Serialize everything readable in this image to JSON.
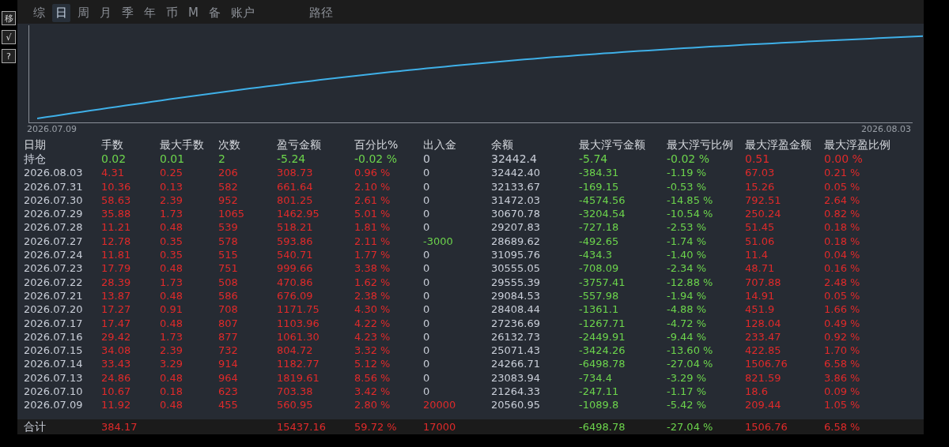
{
  "side_buttons": [
    "移",
    "√",
    "?"
  ],
  "tabs": [
    {
      "label": "综",
      "selected": false
    },
    {
      "label": "日",
      "selected": true
    },
    {
      "label": "周",
      "selected": false
    },
    {
      "label": "月",
      "selected": false
    },
    {
      "label": "季",
      "selected": false
    },
    {
      "label": "年",
      "selected": false
    },
    {
      "label": "币",
      "selected": false
    },
    {
      "label": "M",
      "selected": false
    },
    {
      "label": "备",
      "selected": false
    },
    {
      "label": "账户",
      "selected": false
    }
  ],
  "path_tab": {
    "label": "路径",
    "selected": false
  },
  "chart": {
    "start_label": "2026.07.09",
    "end_label": "2026.08.03"
  },
  "table": {
    "columns": [
      "日期",
      "手数",
      "最大手数",
      "次数",
      "盈亏金额",
      "百分比%",
      "出入金",
      "余额",
      "最大浮亏金额",
      "最大浮亏比例",
      "最大浮盈金额",
      "最大浮盈比例"
    ],
    "rows": [
      {
        "kind": "position",
        "cells": [
          "持仓",
          "0.02",
          "0.01",
          "2",
          "-5.24",
          "-0.02 %",
          "0",
          "32442.4",
          "-5.74",
          "-0.02 %",
          "0.51",
          "0.00 %"
        ]
      },
      {
        "kind": "day",
        "cells": [
          "2026.08.03",
          "4.31",
          "0.25",
          "206",
          "308.73",
          "0.96 %",
          "0",
          "32442.40",
          "-384.31",
          "-1.19 %",
          "67.03",
          "0.21 %"
        ]
      },
      {
        "kind": "day",
        "cells": [
          "2026.07.31",
          "10.36",
          "0.13",
          "582",
          "661.64",
          "2.10 %",
          "0",
          "32133.67",
          "-169.15",
          "-0.53 %",
          "15.26",
          "0.05 %"
        ]
      },
      {
        "kind": "day",
        "cells": [
          "2026.07.30",
          "58.63",
          "2.39",
          "952",
          "801.25",
          "2.61 %",
          "0",
          "31472.03",
          "-4574.56",
          "-14.85 %",
          "792.51",
          "2.64 %"
        ]
      },
      {
        "kind": "day",
        "cells": [
          "2026.07.29",
          "35.88",
          "1.73",
          "1065",
          "1462.95",
          "5.01 %",
          "0",
          "30670.78",
          "-3204.54",
          "-10.54 %",
          "250.24",
          "0.82 %"
        ]
      },
      {
        "kind": "day",
        "cells": [
          "2026.07.28",
          "11.21",
          "0.48",
          "539",
          "518.21",
          "1.81 %",
          "0",
          "29207.83",
          "-727.18",
          "-2.53 %",
          "51.45",
          "0.18 %"
        ]
      },
      {
        "kind": "day",
        "cells": [
          "2026.07.27",
          "12.78",
          "0.35",
          "578",
          "593.86",
          "2.11 %",
          {
            "text": "-3000",
            "color": "#6cd44c"
          },
          "28689.62",
          "-492.65",
          "-1.74 %",
          "51.06",
          "0.18 %"
        ]
      },
      {
        "kind": "day",
        "cells": [
          "2026.07.24",
          "11.81",
          "0.35",
          "515",
          "540.71",
          "1.77 %",
          "0",
          "31095.76",
          "-434.3",
          "-1.40 %",
          "11.4",
          "0.04 %"
        ]
      },
      {
        "kind": "day",
        "cells": [
          "2026.07.23",
          "17.79",
          "0.48",
          "751",
          "999.66",
          "3.38 %",
          "0",
          "30555.05",
          "-708.09",
          "-2.34 %",
          "48.71",
          "0.16 %"
        ]
      },
      {
        "kind": "day",
        "cells": [
          "2026.07.22",
          "28.39",
          "1.73",
          "508",
          "470.86",
          "1.62 %",
          "0",
          "29555.39",
          "-3757.41",
          "-12.88 %",
          "707.88",
          "2.48 %"
        ]
      },
      {
        "kind": "day",
        "cells": [
          "2026.07.21",
          "13.87",
          "0.48",
          "586",
          "676.09",
          "2.38 %",
          "0",
          "29084.53",
          "-557.98",
          "-1.94 %",
          "14.91",
          "0.05 %"
        ]
      },
      {
        "kind": "day",
        "cells": [
          "2026.07.20",
          "17.27",
          "0.91",
          "708",
          "1171.75",
          "4.30 %",
          "0",
          "28408.44",
          "-1361.1",
          "-4.88 %",
          "451.9",
          "1.66 %"
        ]
      },
      {
        "kind": "day",
        "cells": [
          "2026.07.17",
          "17.47",
          "0.48",
          "807",
          "1103.96",
          "4.22 %",
          "0",
          "27236.69",
          "-1267.71",
          "-4.72 %",
          "128.04",
          "0.49 %"
        ]
      },
      {
        "kind": "day",
        "cells": [
          "2026.07.16",
          "29.42",
          "1.73",
          "877",
          "1061.30",
          "4.23 %",
          "0",
          "26132.73",
          "-2449.91",
          "-9.44 %",
          "233.47",
          "0.92 %"
        ]
      },
      {
        "kind": "day",
        "cells": [
          "2026.07.15",
          "34.08",
          "2.39",
          "732",
          "804.72",
          "3.32 %",
          "0",
          "25071.43",
          "-3424.26",
          "-13.60 %",
          "422.85",
          "1.70 %"
        ]
      },
      {
        "kind": "day",
        "cells": [
          "2026.07.14",
          "33.43",
          "3.29",
          "914",
          "1182.77",
          "5.12 %",
          "0",
          "24266.71",
          "-6498.78",
          "-27.04 %",
          "1506.76",
          "6.58 %"
        ]
      },
      {
        "kind": "day",
        "cells": [
          "2026.07.13",
          "24.86",
          "0.48",
          "964",
          "1819.61",
          "8.56 %",
          "0",
          "23083.94",
          "-734.4",
          "-3.29 %",
          "821.59",
          "3.86 %"
        ]
      },
      {
        "kind": "day",
        "cells": [
          "2026.07.10",
          "10.67",
          "0.18",
          "623",
          "703.38",
          "3.42 %",
          "0",
          "21264.33",
          "-247.11",
          "-1.17 %",
          "18.6",
          "0.09 %"
        ]
      },
      {
        "kind": "day",
        "cells": [
          "2026.07.09",
          "11.92",
          "0.48",
          "455",
          "560.95",
          "2.80 %",
          {
            "text": "20000",
            "color": "#e02a2a"
          },
          "20560.95",
          "-1089.8",
          "-5.42 %",
          "209.44",
          "1.05 %"
        ]
      }
    ],
    "total": {
      "cells": [
        "合计",
        "384.17",
        "",
        "",
        "15437.16",
        "59.72 %",
        {
          "text": "17000",
          "color": "#e02a2a"
        },
        "",
        "-6498.78",
        "-27.04 %",
        "1506.76",
        "6.58 %"
      ]
    }
  }
}
